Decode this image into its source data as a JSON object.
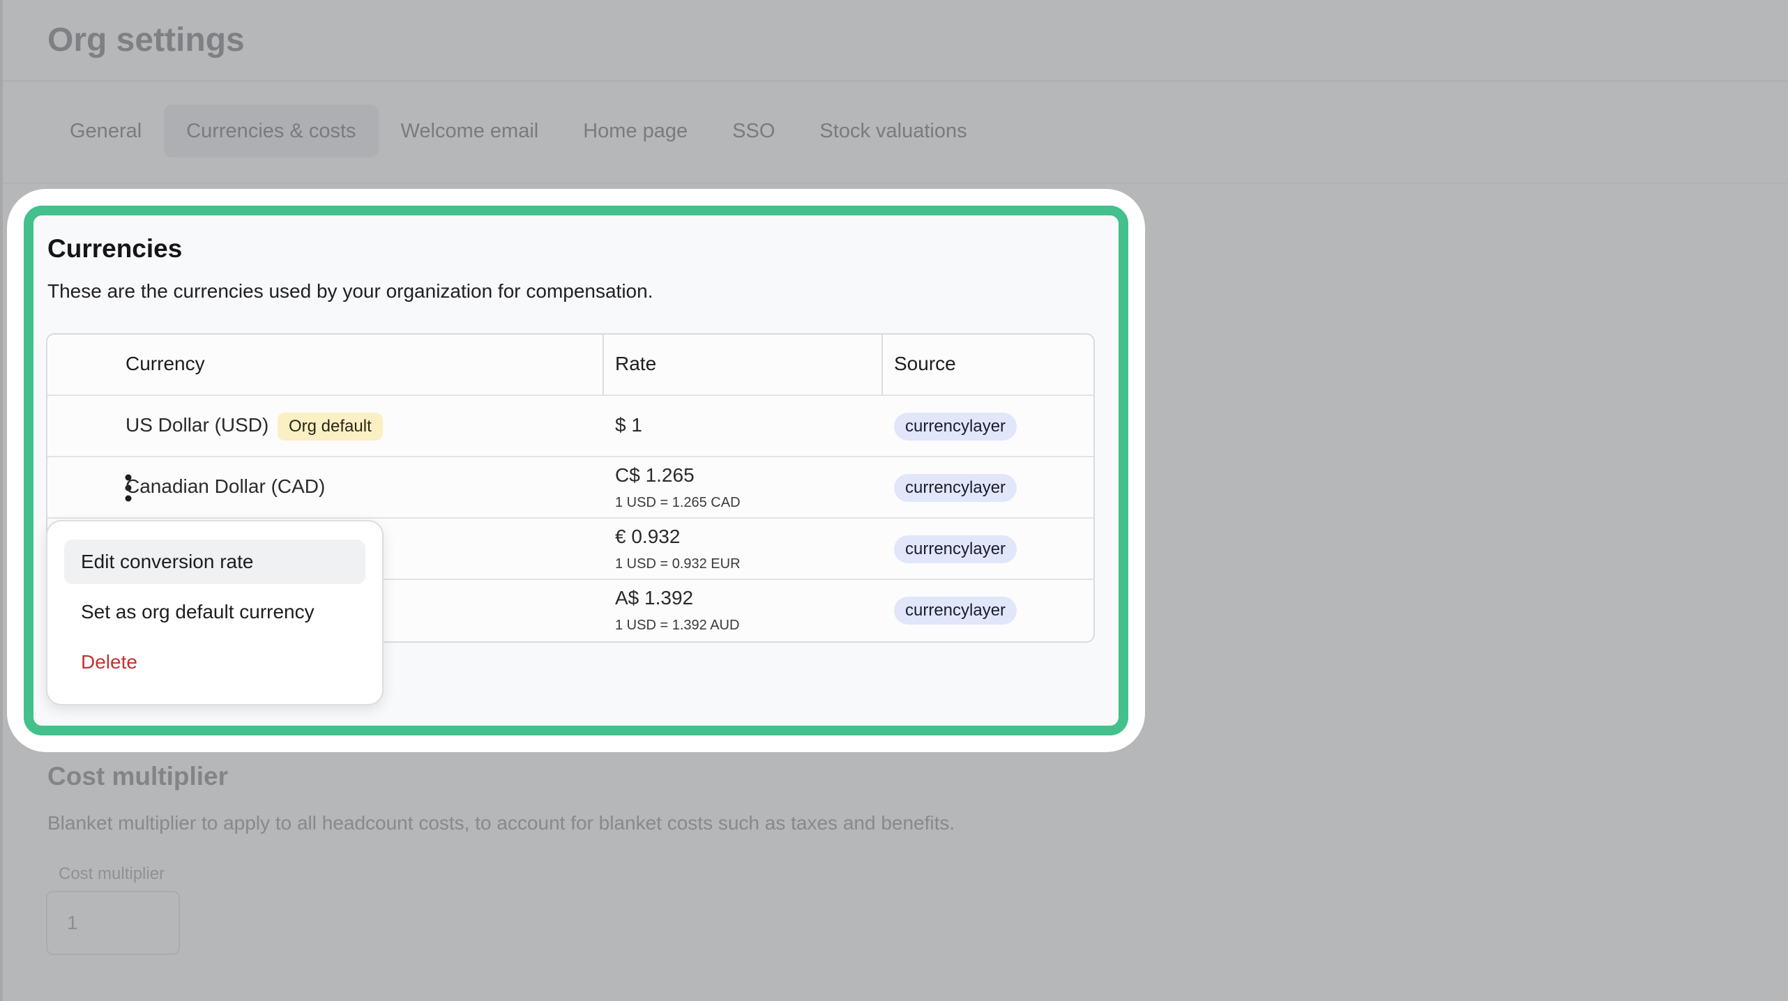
{
  "page": {
    "title": "Org settings",
    "tabs": [
      {
        "label": "General",
        "active": false
      },
      {
        "label": "Currencies & costs",
        "active": true
      },
      {
        "label": "Welcome email",
        "active": false
      },
      {
        "label": "Home page",
        "active": false
      },
      {
        "label": "SSO",
        "active": false
      },
      {
        "label": "Stock valuations",
        "active": false
      }
    ]
  },
  "currencies": {
    "title": "Currencies",
    "description": "These are the currencies used by your organization for compensation.",
    "columns": {
      "currency": "Currency",
      "rate": "Rate",
      "source": "Source"
    },
    "rows": [
      {
        "name": "US Dollar (USD)",
        "badge": "Org default",
        "rate": "$ 1",
        "rate_detail": "",
        "source": "currencylayer"
      },
      {
        "name": "Canadian Dollar (CAD)",
        "badge": "",
        "rate": "C$ 1.265",
        "rate_detail": "1 USD = 1.265 CAD",
        "source": "currencylayer"
      },
      {
        "name": "",
        "badge": "",
        "rate": "€ 0.932",
        "rate_detail": "1 USD = 0.932 EUR",
        "source": "currencylayer"
      },
      {
        "name": "",
        "badge": "",
        "rate": "A$ 1.392",
        "rate_detail": "1 USD = 1.392 AUD",
        "source": "currencylayer"
      }
    ],
    "menu": {
      "items": [
        {
          "label": "Edit conversion rate"
        },
        {
          "label": "Set as org default currency"
        },
        {
          "label": "Delete"
        }
      ]
    }
  },
  "cost_multiplier": {
    "title": "Cost multiplier",
    "description": "Blanket multiplier to apply to all headcount costs, to account for blanket costs such as taxes and benefits.",
    "field_label": "Cost multiplier",
    "value": "1"
  },
  "colors": {
    "highlight_border": "#43c08b",
    "source_pill": "#e1e6fa",
    "default_badge": "#fbf0c4",
    "danger": "#c4312f",
    "overlay": "#b6b7b9"
  },
  "icons": {
    "row_actions": "kebab-vertical-icon"
  }
}
